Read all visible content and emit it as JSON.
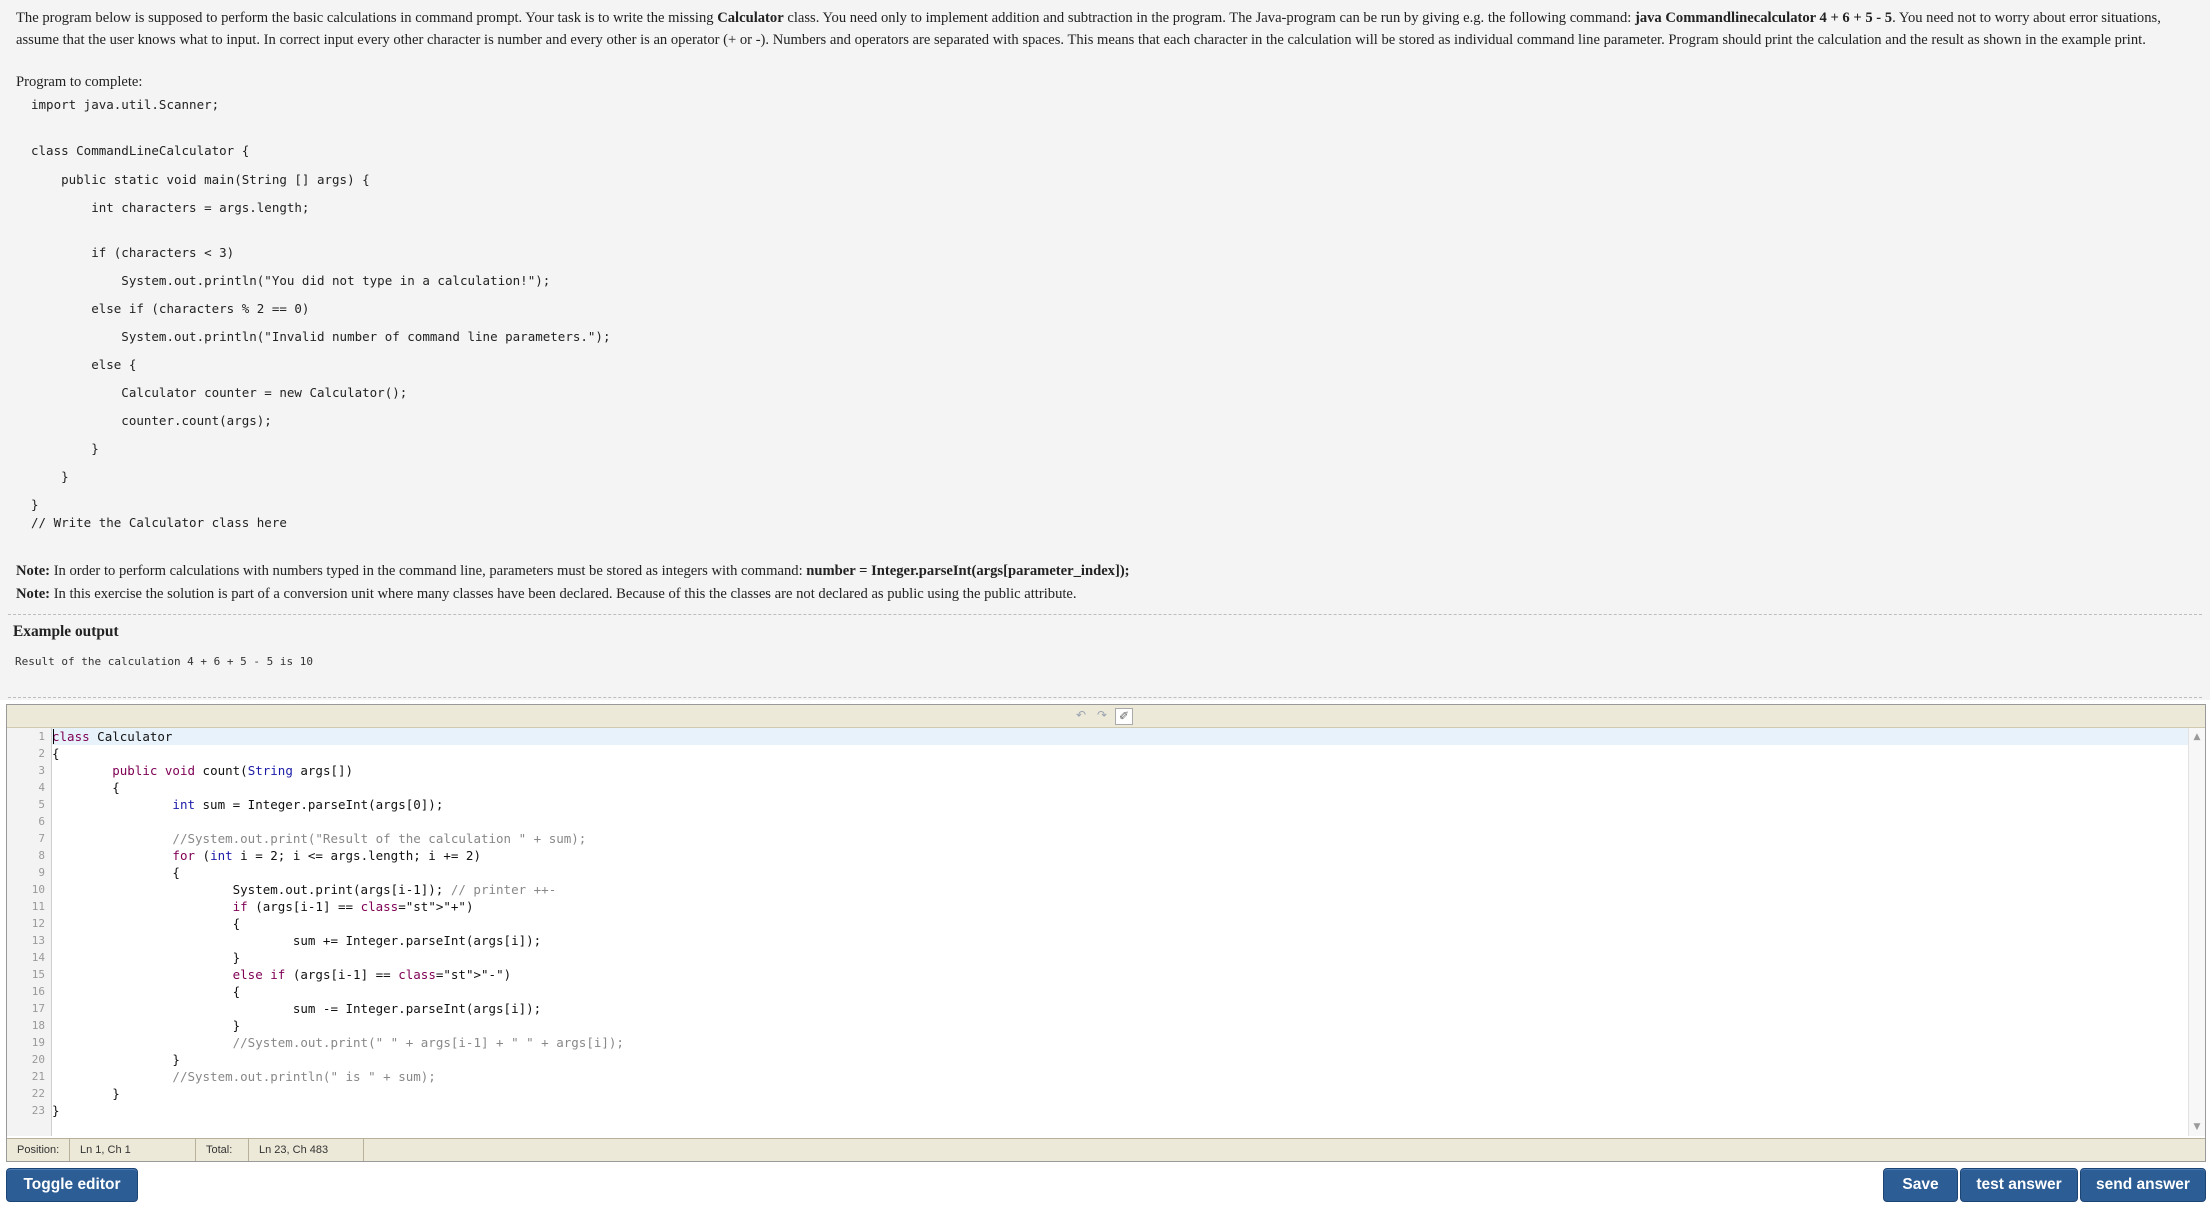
{
  "assignment": {
    "intro_1": "The program below is supposed to perform the basic calculations in command prompt. Your task is to write the missing ",
    "intro_class": "Calculator",
    "intro_2": " class. You need only to implement addition and subtraction in the program. The Java-program can be run by giving e.g. the following command: ",
    "intro_cmd": "java Commandlinecalculator 4 + 6 + 5 - 5",
    "intro_3": ". You need not to worry about error situations, assume that the user knows what to input. In correct input every other character is number and every other is an operator (+ or -). Numbers and operators are separated with spaces. This means that each character in the calculation will be stored as individual command line parameter. Program should print the calculation and the result as shown in the example print.",
    "program_label": "Program to complete:",
    "program_lines": [
      "import java.util.Scanner;",
      "",
      "class CommandLineCalculator {",
      "    public static void main(String [] args) {",
      "        int characters = args.length;",
      "",
      "        if (characters < 3)",
      "            System.out.println(\"You did not type in a calculation!\");",
      "        else if (characters % 2 == 0)",
      "            System.out.println(\"Invalid number of command line parameters.\");",
      "        else {",
      "            Calculator counter = new Calculator();",
      "            counter.count(args);",
      "        }",
      "    }",
      "}",
      "// Write the Calculator class here"
    ],
    "note_label": "Note:",
    "note1_text": " In order to perform calculations with numbers typed in the command line, parameters must be stored as integers with command: ",
    "note1_cmd": "number = Integer.parseInt(args[parameter_index]);",
    "note2_text": " In this exercise the solution is part of a conversion unit where many classes have been declared. Because of this the classes are not declared as public using the public attribute.",
    "example_title": "Example output",
    "example_output": "Result of the calculation 4 + 6 + 5 - 5 is 10"
  },
  "editor": {
    "toolbar": {
      "undo_icon": "↶",
      "redo_icon": "↷",
      "format_icon": "✐"
    },
    "line_numbers": [
      "1",
      "2",
      "3",
      "4",
      "5",
      "6",
      "7",
      "8",
      "9",
      "10",
      "11",
      "12",
      "13",
      "14",
      "15",
      "16",
      "17",
      "18",
      "19",
      "20",
      "21",
      "22",
      "23"
    ],
    "code_lines": [
      "class Calculator",
      "{",
      "        public void count(String args[])",
      "        {",
      "                int sum = Integer.parseInt(args[0]);",
      "",
      "                //System.out.print(\"Result of the calculation \" + sum);",
      "                for (int i = 2; i <= args.length; i += 2)",
      "                {",
      "                        System.out.print(args[i-1]); // printer ++-",
      "                        if (args[i-1] == \"+\")",
      "                        {",
      "                                sum += Integer.parseInt(args[i]);",
      "                        }",
      "                        else if (args[i-1] == \"-\")",
      "                        {",
      "                                sum -= Integer.parseInt(args[i]);",
      "                        }",
      "                        //System.out.print(\" \" + args[i-1] + \" \" + args[i]);",
      "                }",
      "                //System.out.println(\" is \" + sum);",
      "        }",
      "}"
    ],
    "status": {
      "position_label": "Position:",
      "position_value": "Ln 1, Ch 1",
      "total_label": "Total:",
      "total_value": "Ln 23, Ch 483"
    }
  },
  "buttons": {
    "toggle_editor": "Toggle editor",
    "save": "Save",
    "test_answer": "test answer",
    "send_answer": "send answer"
  }
}
